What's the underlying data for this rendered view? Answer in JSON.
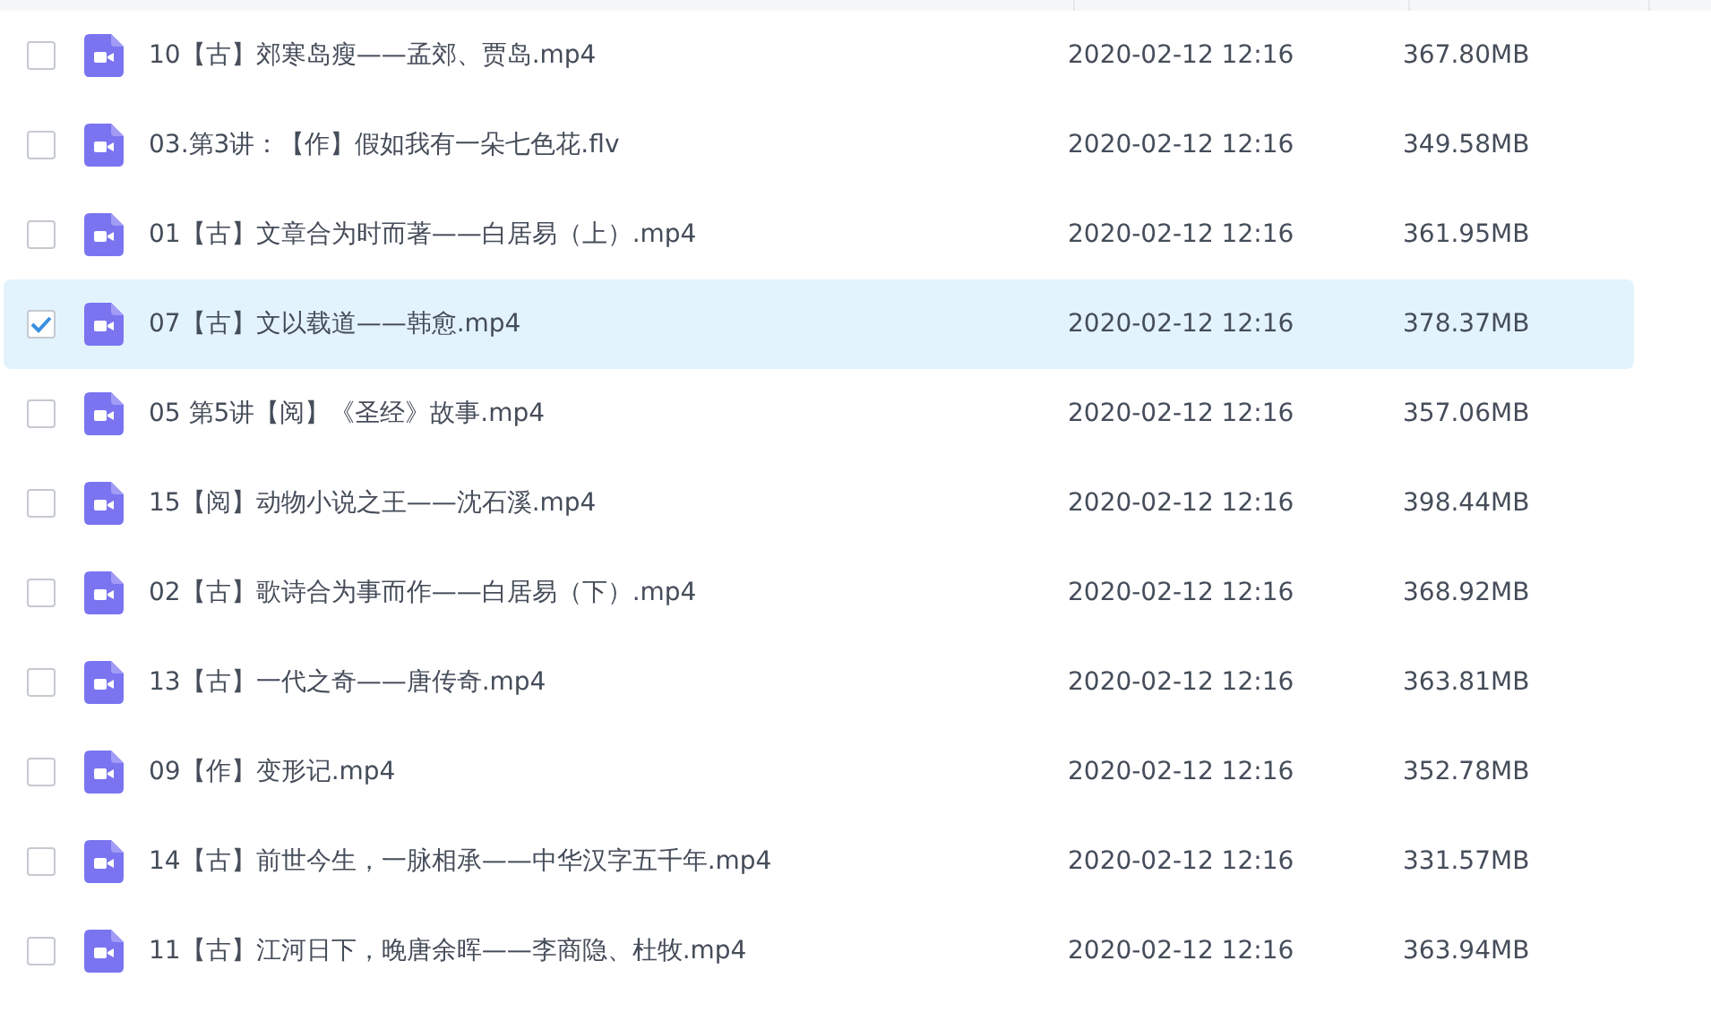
{
  "files": [
    {
      "name": "10【古】郊寒岛瘦——孟郊、贾岛.mp4",
      "date": "2020-02-12 12:16",
      "size": "367.80MB",
      "selected": false
    },
    {
      "name": "03.第3讲：【作】假如我有一朵七色花.flv",
      "date": "2020-02-12 12:16",
      "size": "349.58MB",
      "selected": false
    },
    {
      "name": "01【古】文章合为时而著——白居易（上）.mp4",
      "date": "2020-02-12 12:16",
      "size": "361.95MB",
      "selected": false
    },
    {
      "name": "07【古】文以载道——韩愈.mp4",
      "date": "2020-02-12 12:16",
      "size": "378.37MB",
      "selected": true
    },
    {
      "name": "05 第5讲【阅】《圣经》故事.mp4",
      "date": "2020-02-12 12:16",
      "size": "357.06MB",
      "selected": false
    },
    {
      "name": "15【阅】动物小说之王——沈石溪.mp4",
      "date": "2020-02-12 12:16",
      "size": "398.44MB",
      "selected": false
    },
    {
      "name": "02【古】歌诗合为事而作——白居易（下）.mp4",
      "date": "2020-02-12 12:16",
      "size": "368.92MB",
      "selected": false
    },
    {
      "name": "13【古】一代之奇——唐传奇.mp4",
      "date": "2020-02-12 12:16",
      "size": "363.81MB",
      "selected": false
    },
    {
      "name": "09【作】变形记.mp4",
      "date": "2020-02-12 12:16",
      "size": "352.78MB",
      "selected": false
    },
    {
      "name": "14【古】前世今生，一脉相承——中华汉字五千年.mp4",
      "date": "2020-02-12 12:16",
      "size": "331.57MB",
      "selected": false
    },
    {
      "name": "11【古】江河日下，晚唐余晖——李商隐、杜牧.mp4",
      "date": "2020-02-12 12:16",
      "size": "363.94MB",
      "selected": false
    }
  ]
}
